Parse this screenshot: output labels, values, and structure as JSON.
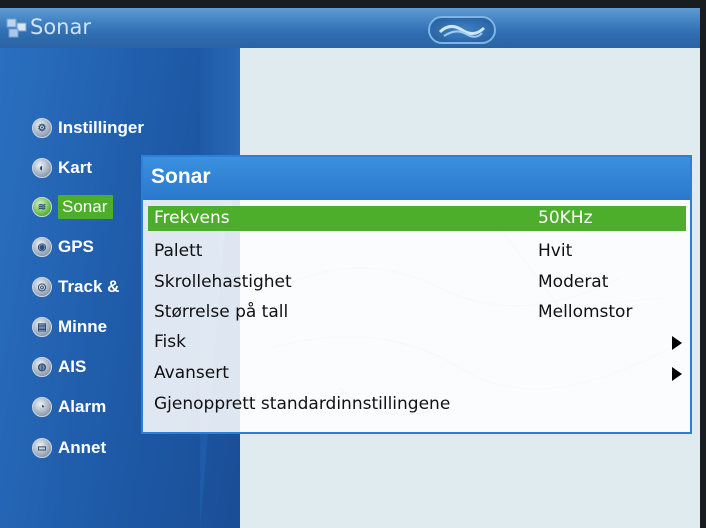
{
  "app": {
    "title": "Sonar",
    "brand_logo": "wave-fish-logo"
  },
  "sidebar": {
    "items": [
      {
        "label": "Instillinger",
        "icon": "settings-icon"
      },
      {
        "label": "Kart",
        "icon": "map-icon"
      },
      {
        "label": "Sonar",
        "icon": "sonar-icon",
        "active": true
      },
      {
        "label": "GPS",
        "icon": "gps-icon"
      },
      {
        "label": "Track &",
        "icon": "track-icon"
      },
      {
        "label": "Minne",
        "icon": "memory-icon"
      },
      {
        "label": "AIS",
        "icon": "ais-icon"
      },
      {
        "label": "Alarm",
        "icon": "alarm-icon"
      },
      {
        "label": "Annet",
        "icon": "other-icon"
      }
    ]
  },
  "dialog": {
    "title": "Sonar",
    "rows": [
      {
        "label": "Frekvens",
        "value": "50KHz",
        "selected": true
      },
      {
        "label": "Palett",
        "value": "Hvit"
      },
      {
        "label": "Skrollehastighet",
        "value": "Moderat"
      },
      {
        "label": "Størrelse på tall",
        "value": "Mellomstor"
      },
      {
        "label": "Fisk",
        "value": "",
        "submenu": true
      },
      {
        "label": "Avansert",
        "value": "",
        "submenu": true
      },
      {
        "label": "Gjenopprett standardinnstillingene",
        "value": ""
      }
    ]
  },
  "colors": {
    "header_blue": "#2a78cc",
    "sidebar_blue": "#1e5aa8",
    "selection_green": "#4cae2a"
  }
}
